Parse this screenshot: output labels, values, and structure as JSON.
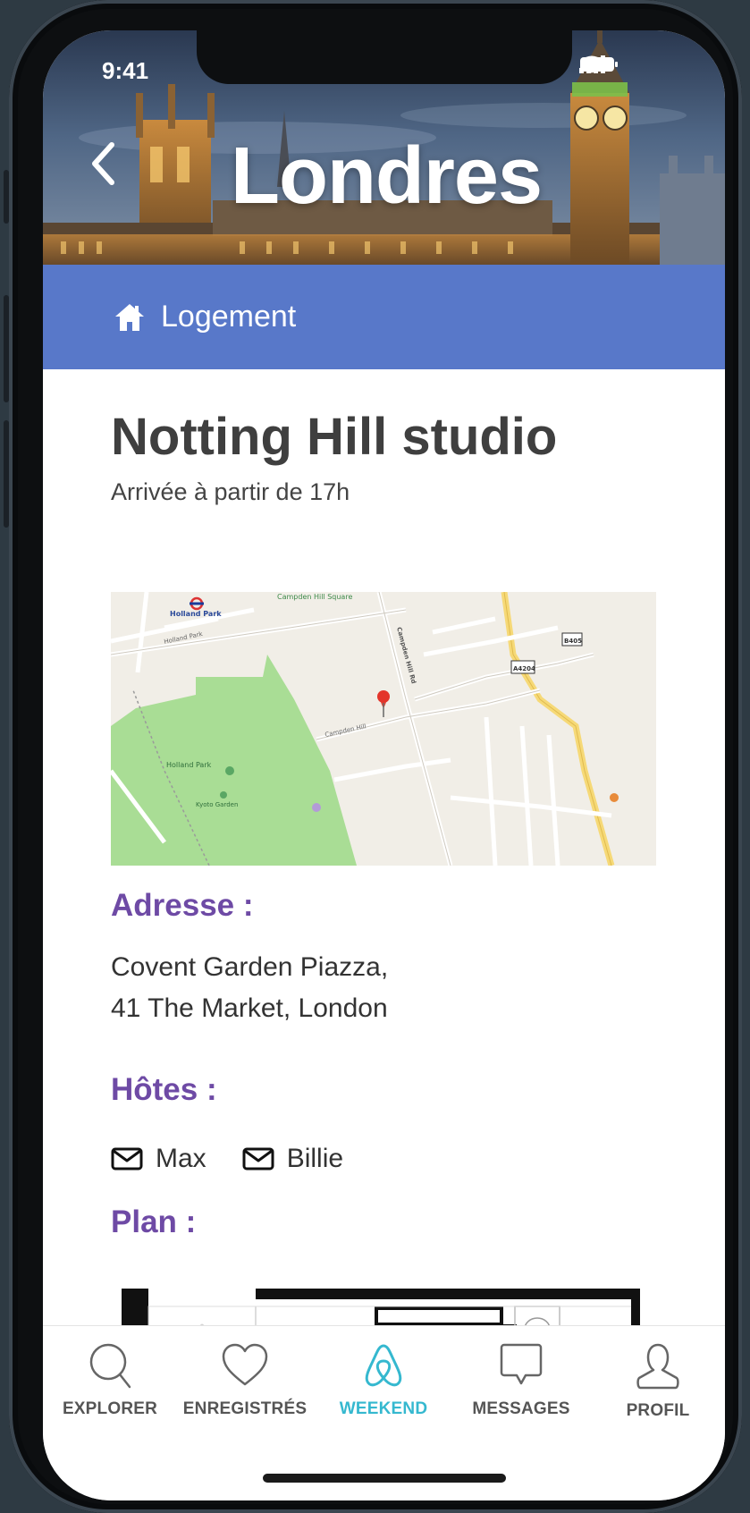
{
  "status_bar": {
    "time": "9:41"
  },
  "header": {
    "city_title": "Londres"
  },
  "section": {
    "label": "Logement"
  },
  "listing": {
    "title": "Notting Hill studio",
    "checkin": "Arrivée à partir de 17h"
  },
  "map": {
    "labels": {
      "holland_park_station": "Holland Park",
      "campden_hill_square": "Campden Hill Square",
      "holland_park": "Holland Park",
      "kyoto_garden": "Kyoto Garden",
      "holland_park_rd": "Holland Park",
      "campden_hill_rd": "Campden Hill Rd",
      "campden_hill": "Campden Hill",
      "road_a4204": "A4204",
      "road_b405": "B405"
    }
  },
  "address": {
    "heading": "Adresse :",
    "line1": "Covent Garden Piazza,",
    "line2": "41 The Market, London"
  },
  "hosts": {
    "heading": "Hôtes :",
    "items": [
      {
        "name": "Max"
      },
      {
        "name": "Billie"
      }
    ]
  },
  "plan": {
    "heading": "Plan :"
  },
  "tabbar": {
    "tabs": [
      {
        "label": "EXPLORER",
        "icon": "search-icon"
      },
      {
        "label": "ENREGISTRÉS",
        "icon": "heart-icon"
      },
      {
        "label": "WEEKEND",
        "icon": "airbnb-logo-icon",
        "active": true
      },
      {
        "label": "MESSAGES",
        "icon": "message-icon"
      },
      {
        "label": "PROFIL",
        "icon": "profile-icon"
      }
    ]
  },
  "colors": {
    "section_bar": "#5878c9",
    "heading_purple": "#6e4aa5",
    "active_tab": "#35b8cf"
  }
}
